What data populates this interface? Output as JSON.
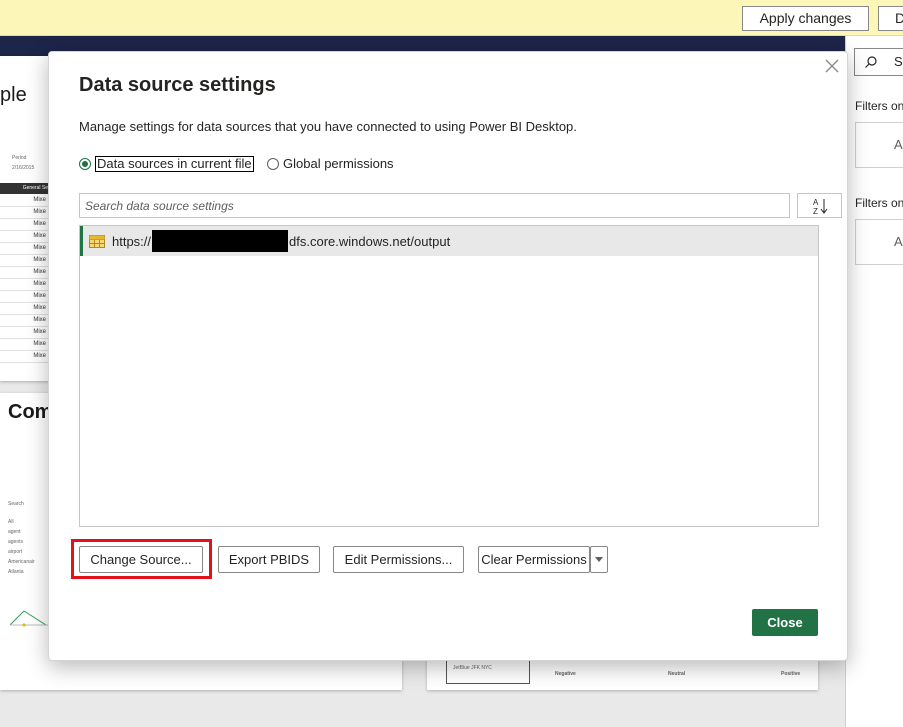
{
  "notification_bar": {
    "apply_changes_label": "Apply changes",
    "discard_label_partial": "D"
  },
  "background": {
    "card1_partial_text": "ple",
    "card1_date": "2/16/2015",
    "card1_header": "General Se",
    "card1_rows": [
      "Mixe",
      "Mixe",
      "Mixe",
      "Mixe",
      "Mixe",
      "Mixe",
      "Mixe",
      "Mixe",
      "Mixe",
      "Mixe",
      "Mixe",
      "Mixe",
      "Mixe",
      "Mixe"
    ],
    "card2_partial_text": "Com",
    "card2_search_label": "Search",
    "card2_filter_items": [
      "All",
      "agent",
      "agents",
      "airport",
      "Americanair",
      "Atlanta"
    ],
    "card3_items": [
      "JetBlue JFK NYC"
    ],
    "card3_axis_labels": [
      "Negative",
      "Neutral",
      "Positive"
    ]
  },
  "right_pane": {
    "search_partial": "Se",
    "filters_label_1": "Filters on",
    "card_1_partial": "Ad",
    "filters_label_2": "Filters on",
    "card_2_partial": "Ad"
  },
  "dialog": {
    "title": "Data source settings",
    "description": "Manage settings for data sources that you have connected to using Power BI Desktop.",
    "radio_options": [
      {
        "label": "Data sources in current file",
        "checked": true
      },
      {
        "label": "Global permissions",
        "checked": false
      }
    ],
    "search_placeholder": "Search data source settings",
    "sort_icon": "sort-az-icon",
    "data_sources": [
      {
        "url_prefix": "https://",
        "url_suffix": "dfs.core.windows.net/output",
        "icon": "table-icon"
      }
    ],
    "buttons": {
      "change_source": "Change Source...",
      "export_pbids": "Export PBIDS",
      "edit_permissions": "Edit Permissions...",
      "clear_permissions": "Clear Permissions",
      "close": "Close"
    },
    "close_icon": "close-icon"
  },
  "colors": {
    "accent": "#217346",
    "highlight": "#e2121b",
    "notification_bg": "#fcf6b8",
    "header_band": "#1d2549"
  }
}
